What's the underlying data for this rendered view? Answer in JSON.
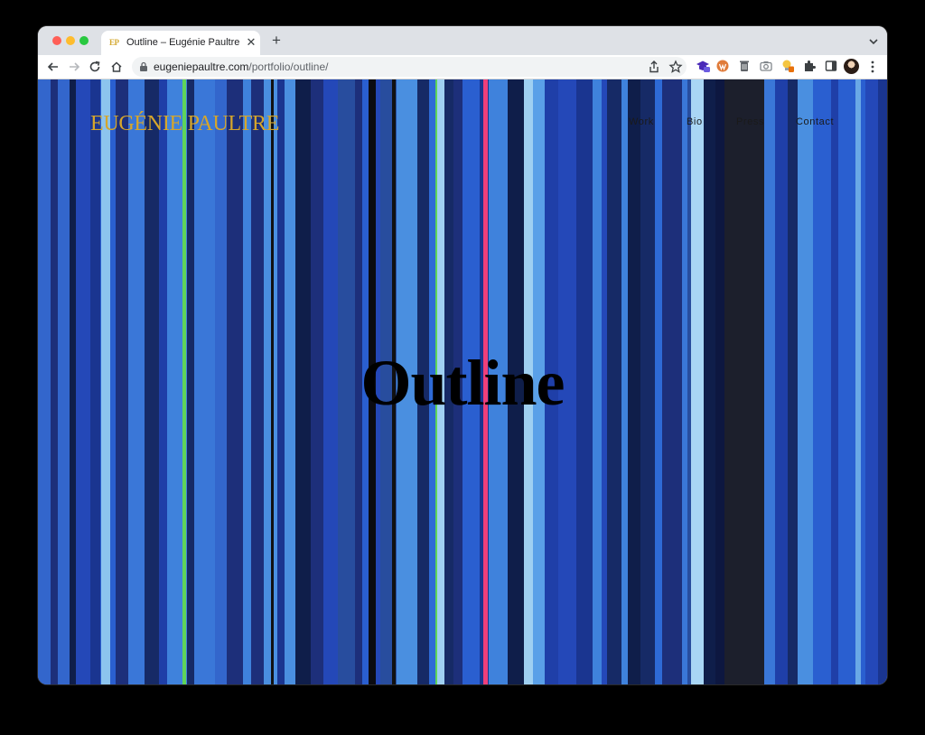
{
  "browser": {
    "tab": {
      "favicon_text": "EP",
      "title": "Outline – Eugénie Paultre"
    },
    "url": {
      "host": "eugeniepaultre.com",
      "path": "/portfolio/outline/"
    },
    "icons": {
      "back": "back-arrow-icon",
      "forward": "forward-arrow-icon",
      "reload": "reload-icon",
      "home": "home-icon",
      "lock": "lock-icon",
      "share": "share-icon",
      "star": "star-icon",
      "extensions": "puzzle-icon",
      "side_panel": "side-panel-icon",
      "menu": "kebab-menu-icon"
    }
  },
  "site": {
    "logo": "EUGÉNIE PAULTRE",
    "nav": [
      "Work",
      "Bio",
      "Press",
      "Contact"
    ],
    "hero_title": "Outline"
  },
  "colors": {
    "logo": "#d6a62b",
    "painting_base": "#2a5ac8",
    "accent_green": "#5fd45a",
    "accent_pink": "#ef3f7a"
  }
}
